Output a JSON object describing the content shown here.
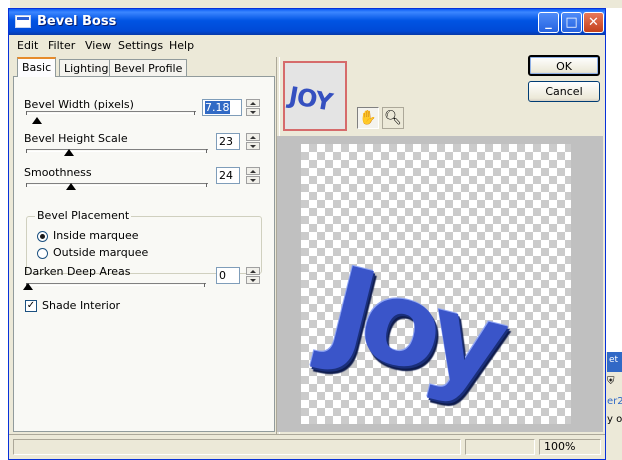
{
  "window": {
    "title": "Bevel Boss"
  },
  "title_buttons": {
    "minimize": "_",
    "maximize": "□",
    "close": "✕"
  },
  "menu": [
    "Edit",
    "Filter",
    "View",
    "Settings",
    "Help"
  ],
  "tabs": [
    {
      "label": "Basic",
      "active": true
    },
    {
      "label": "Lighting",
      "active": false
    },
    {
      "label": "Bevel Profile",
      "active": false
    }
  ],
  "basic": {
    "bevel_width": {
      "label": "Bevel Width (pixels)",
      "value": "7.18"
    },
    "bevel_height": {
      "label": "Bevel Height Scale",
      "value": "23"
    },
    "smoothness": {
      "label": "Smoothness",
      "value": "24"
    },
    "placement": {
      "title": "Bevel Placement",
      "options": [
        {
          "label": "Inside marquee",
          "selected": true
        },
        {
          "label": "Outside marquee",
          "selected": false
        }
      ]
    },
    "darken": {
      "label": "Darken Deep Areas",
      "value": "0"
    },
    "shade_interior": {
      "label": "Shade Interior",
      "checked": true
    }
  },
  "buttons": {
    "ok": "OK",
    "cancel": "Cancel"
  },
  "thumbnail": {
    "text": "JOY"
  },
  "tools": {
    "pan_icon": "hand-icon",
    "zoom_icon": "magnifier-icon"
  },
  "preview": {
    "text": "Joy",
    "color": "#3a55c9"
  },
  "status": {
    "zoom": "100%"
  },
  "background_fragments": {
    "right1": "et",
    "right2": "er2",
    "right3": "y o"
  }
}
